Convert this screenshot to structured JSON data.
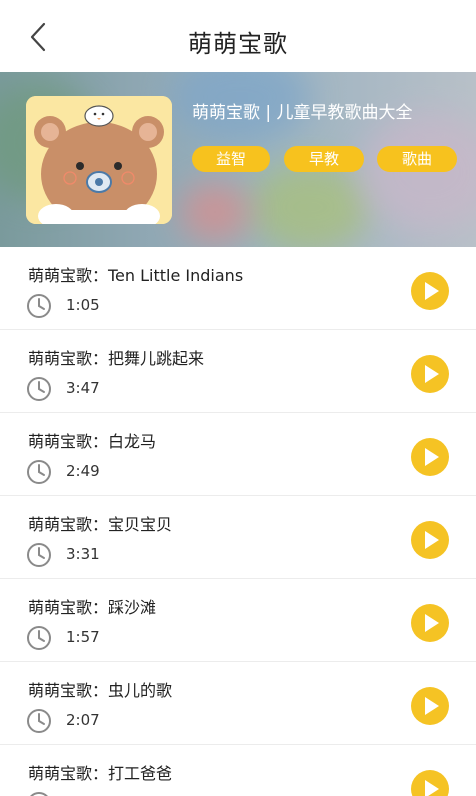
{
  "header": {
    "title": "萌萌宝歌"
  },
  "album": {
    "name": "萌萌宝歌 | 儿童早教歌曲大全",
    "tags": [
      "益智",
      "早教",
      "歌曲"
    ]
  },
  "songs": [
    {
      "title": "萌萌宝歌：Ten Little Indians",
      "duration": "1:05"
    },
    {
      "title": "萌萌宝歌：把舞儿跳起来",
      "duration": "3:47"
    },
    {
      "title": "萌萌宝歌：白龙马",
      "duration": "2:49"
    },
    {
      "title": "萌萌宝歌：宝贝宝贝",
      "duration": "3:31"
    },
    {
      "title": "萌萌宝歌：踩沙滩",
      "duration": "1:57"
    },
    {
      "title": "萌萌宝歌：虫儿的歌",
      "duration": "2:07"
    },
    {
      "title": "萌萌宝歌：打工爸爸",
      "duration": ""
    }
  ],
  "colors": {
    "accent": "#f7c21e",
    "play_button": "#f5c324",
    "divider": "#ececec"
  },
  "icons": {
    "back": "chevron-left-icon",
    "duration": "clock-icon",
    "play": "play-icon"
  }
}
